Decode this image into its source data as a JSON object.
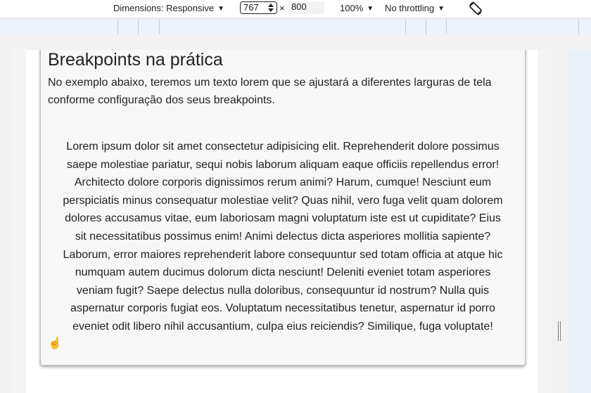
{
  "toolbar": {
    "dimensions_label": "Dimensions: Responsive",
    "width_value": "767",
    "times": "×",
    "height_value": "800",
    "zoom_label": "100%",
    "throttle_label": "No throttling",
    "caret": "▼",
    "rotate_icon": "rotate-icon"
  },
  "page": {
    "title": "Breakpoints na prática",
    "intro": "No exemplo abaixo, teremos um texto lorem que se ajustará a diferentes larguras de tela conforme configuração dos seus breakpoints.",
    "lorem": "Lorem ipsum dolor sit amet consectetur adipisicing elit. Reprehenderit dolore possimus saepe molestiae pariatur, sequi nobis laborum aliquam eaque officiis repellendus error! Architecto dolore corporis dignissimos rerum animi? Harum, cumque! Nesciunt eum perspiciatis minus consequatur molestiae velit? Quas nihil, vero fuga velit quam dolorem dolores accusamus vitae, eum laboriosam magni voluptatum iste est ut cupiditate? Eius sit necessitatibus possimus enim! Animi delectus dicta asperiores mollitia sapiente? Laborum, error maiores reprehenderit labore consequuntur sed totam officia at atque hic numquam autem ducimus dolorum dicta nesciunt! Deleniti eveniet totam asperiores veniam fugit? Saepe delectus nulla doloribus, consequuntur id nostrum? Nulla quis aspernatur corporis fugiat eos. Voluptatum necessitatibus tenetur, aspernatur id porro eveniet odit libero nihil accusantium, culpa eius reiciendis? Similique, fuga voluptate!",
    "emoji": "☝"
  },
  "colors": {
    "mq_bar": "#eef3fb",
    "card_bg": "#f7f7f7",
    "emoji": "#f0b400"
  }
}
